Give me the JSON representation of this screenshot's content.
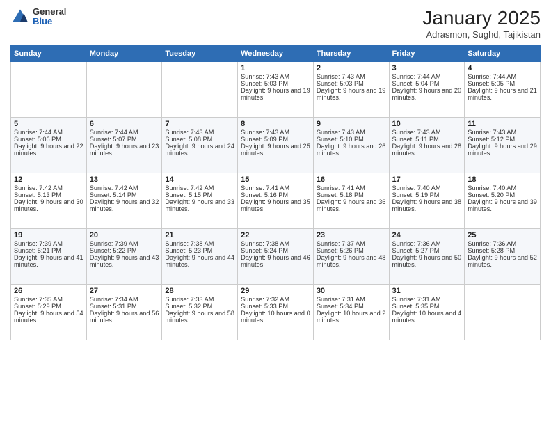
{
  "header": {
    "logo_general": "General",
    "logo_blue": "Blue",
    "month_title": "January 2025",
    "subtitle": "Adrasmon, Sughd, Tajikistan"
  },
  "weekdays": [
    "Sunday",
    "Monday",
    "Tuesday",
    "Wednesday",
    "Thursday",
    "Friday",
    "Saturday"
  ],
  "weeks": [
    [
      {
        "day": "",
        "sunrise": "",
        "sunset": "",
        "daylight": ""
      },
      {
        "day": "",
        "sunrise": "",
        "sunset": "",
        "daylight": ""
      },
      {
        "day": "",
        "sunrise": "",
        "sunset": "",
        "daylight": ""
      },
      {
        "day": "1",
        "sunrise": "Sunrise: 7:43 AM",
        "sunset": "Sunset: 5:03 PM",
        "daylight": "Daylight: 9 hours and 19 minutes."
      },
      {
        "day": "2",
        "sunrise": "Sunrise: 7:43 AM",
        "sunset": "Sunset: 5:03 PM",
        "daylight": "Daylight: 9 hours and 19 minutes."
      },
      {
        "day": "3",
        "sunrise": "Sunrise: 7:44 AM",
        "sunset": "Sunset: 5:04 PM",
        "daylight": "Daylight: 9 hours and 20 minutes."
      },
      {
        "day": "4",
        "sunrise": "Sunrise: 7:44 AM",
        "sunset": "Sunset: 5:05 PM",
        "daylight": "Daylight: 9 hours and 21 minutes."
      }
    ],
    [
      {
        "day": "5",
        "sunrise": "Sunrise: 7:44 AM",
        "sunset": "Sunset: 5:06 PM",
        "daylight": "Daylight: 9 hours and 22 minutes."
      },
      {
        "day": "6",
        "sunrise": "Sunrise: 7:44 AM",
        "sunset": "Sunset: 5:07 PM",
        "daylight": "Daylight: 9 hours and 23 minutes."
      },
      {
        "day": "7",
        "sunrise": "Sunrise: 7:43 AM",
        "sunset": "Sunset: 5:08 PM",
        "daylight": "Daylight: 9 hours and 24 minutes."
      },
      {
        "day": "8",
        "sunrise": "Sunrise: 7:43 AM",
        "sunset": "Sunset: 5:09 PM",
        "daylight": "Daylight: 9 hours and 25 minutes."
      },
      {
        "day": "9",
        "sunrise": "Sunrise: 7:43 AM",
        "sunset": "Sunset: 5:10 PM",
        "daylight": "Daylight: 9 hours and 26 minutes."
      },
      {
        "day": "10",
        "sunrise": "Sunrise: 7:43 AM",
        "sunset": "Sunset: 5:11 PM",
        "daylight": "Daylight: 9 hours and 28 minutes."
      },
      {
        "day": "11",
        "sunrise": "Sunrise: 7:43 AM",
        "sunset": "Sunset: 5:12 PM",
        "daylight": "Daylight: 9 hours and 29 minutes."
      }
    ],
    [
      {
        "day": "12",
        "sunrise": "Sunrise: 7:42 AM",
        "sunset": "Sunset: 5:13 PM",
        "daylight": "Daylight: 9 hours and 30 minutes."
      },
      {
        "day": "13",
        "sunrise": "Sunrise: 7:42 AM",
        "sunset": "Sunset: 5:14 PM",
        "daylight": "Daylight: 9 hours and 32 minutes."
      },
      {
        "day": "14",
        "sunrise": "Sunrise: 7:42 AM",
        "sunset": "Sunset: 5:15 PM",
        "daylight": "Daylight: 9 hours and 33 minutes."
      },
      {
        "day": "15",
        "sunrise": "Sunrise: 7:41 AM",
        "sunset": "Sunset: 5:16 PM",
        "daylight": "Daylight: 9 hours and 35 minutes."
      },
      {
        "day": "16",
        "sunrise": "Sunrise: 7:41 AM",
        "sunset": "Sunset: 5:18 PM",
        "daylight": "Daylight: 9 hours and 36 minutes."
      },
      {
        "day": "17",
        "sunrise": "Sunrise: 7:40 AM",
        "sunset": "Sunset: 5:19 PM",
        "daylight": "Daylight: 9 hours and 38 minutes."
      },
      {
        "day": "18",
        "sunrise": "Sunrise: 7:40 AM",
        "sunset": "Sunset: 5:20 PM",
        "daylight": "Daylight: 9 hours and 39 minutes."
      }
    ],
    [
      {
        "day": "19",
        "sunrise": "Sunrise: 7:39 AM",
        "sunset": "Sunset: 5:21 PM",
        "daylight": "Daylight: 9 hours and 41 minutes."
      },
      {
        "day": "20",
        "sunrise": "Sunrise: 7:39 AM",
        "sunset": "Sunset: 5:22 PM",
        "daylight": "Daylight: 9 hours and 43 minutes."
      },
      {
        "day": "21",
        "sunrise": "Sunrise: 7:38 AM",
        "sunset": "Sunset: 5:23 PM",
        "daylight": "Daylight: 9 hours and 44 minutes."
      },
      {
        "day": "22",
        "sunrise": "Sunrise: 7:38 AM",
        "sunset": "Sunset: 5:24 PM",
        "daylight": "Daylight: 9 hours and 46 minutes."
      },
      {
        "day": "23",
        "sunrise": "Sunrise: 7:37 AM",
        "sunset": "Sunset: 5:26 PM",
        "daylight": "Daylight: 9 hours and 48 minutes."
      },
      {
        "day": "24",
        "sunrise": "Sunrise: 7:36 AM",
        "sunset": "Sunset: 5:27 PM",
        "daylight": "Daylight: 9 hours and 50 minutes."
      },
      {
        "day": "25",
        "sunrise": "Sunrise: 7:36 AM",
        "sunset": "Sunset: 5:28 PM",
        "daylight": "Daylight: 9 hours and 52 minutes."
      }
    ],
    [
      {
        "day": "26",
        "sunrise": "Sunrise: 7:35 AM",
        "sunset": "Sunset: 5:29 PM",
        "daylight": "Daylight: 9 hours and 54 minutes."
      },
      {
        "day": "27",
        "sunrise": "Sunrise: 7:34 AM",
        "sunset": "Sunset: 5:31 PM",
        "daylight": "Daylight: 9 hours and 56 minutes."
      },
      {
        "day": "28",
        "sunrise": "Sunrise: 7:33 AM",
        "sunset": "Sunset: 5:32 PM",
        "daylight": "Daylight: 9 hours and 58 minutes."
      },
      {
        "day": "29",
        "sunrise": "Sunrise: 7:32 AM",
        "sunset": "Sunset: 5:33 PM",
        "daylight": "Daylight: 10 hours and 0 minutes."
      },
      {
        "day": "30",
        "sunrise": "Sunrise: 7:31 AM",
        "sunset": "Sunset: 5:34 PM",
        "daylight": "Daylight: 10 hours and 2 minutes."
      },
      {
        "day": "31",
        "sunrise": "Sunrise: 7:31 AM",
        "sunset": "Sunset: 5:35 PM",
        "daylight": "Daylight: 10 hours and 4 minutes."
      },
      {
        "day": "",
        "sunrise": "",
        "sunset": "",
        "daylight": ""
      }
    ]
  ]
}
